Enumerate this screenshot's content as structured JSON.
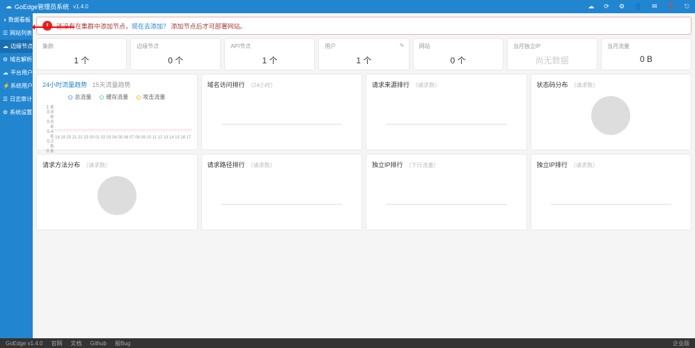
{
  "header": {
    "title": "GoEdge管理员系统",
    "version": "v1.4.0"
  },
  "sidebar": {
    "items": [
      {
        "icon": "◑",
        "label": "数据看板"
      },
      {
        "icon": "☰",
        "label": "网站列表"
      },
      {
        "icon": "☁",
        "label": "边缘节点"
      },
      {
        "icon": "⚙",
        "label": "域名解析"
      },
      {
        "icon": "☁",
        "label": "平台用户"
      },
      {
        "icon": "⚡",
        "label": "系统用户"
      },
      {
        "icon": "☰",
        "label": "日志审计"
      },
      {
        "icon": "⚙",
        "label": "系统设置"
      }
    ]
  },
  "alert": {
    "text_before": "还没有在集群中添加节点，",
    "link": "现在去添加？",
    "text_after": " 添加节点后才可部署网站。"
  },
  "stats": [
    {
      "label": "集群",
      "value": "1 个"
    },
    {
      "label": "边缘节点",
      "value": "0 个"
    },
    {
      "label": "API节点",
      "value": "1 个"
    },
    {
      "label": "用户",
      "value": "1 个",
      "editable": true
    },
    {
      "label": "网站",
      "value": "0 个"
    },
    {
      "label": "当月独立IP",
      "value": "尚无数据",
      "muted": true
    },
    {
      "label": "当月流量",
      "value": "0 B"
    }
  ],
  "traffic_panel": {
    "tab_active": "24小时流量趋势",
    "tab_inactive": "15天流量趋势",
    "legend": [
      "总流量",
      "缓存流量",
      "攻击流量"
    ]
  },
  "chart_data": {
    "type": "line",
    "title": "24小时流量趋势",
    "ylabel": "",
    "ylim": [
      0,
      1
    ],
    "yticks": [
      "1 B",
      "0.8 B",
      "0.6 B",
      "0.4 B",
      "0.2 B",
      "0 B"
    ],
    "categories": [
      "18",
      "19",
      "20",
      "21",
      "22",
      "23",
      "00",
      "01",
      "02",
      "03",
      "04",
      "05",
      "06",
      "07",
      "08",
      "09",
      "10",
      "11",
      "12",
      "13",
      "14",
      "15",
      "16",
      "17"
    ],
    "series": [
      {
        "name": "总流量",
        "values": [
          0,
          0,
          0,
          0,
          0,
          0,
          0,
          0,
          0,
          0,
          0,
          0,
          0,
          0,
          0,
          0,
          0,
          0,
          0,
          0,
          0,
          0,
          0,
          0
        ]
      },
      {
        "name": "缓存流量",
        "values": [
          0,
          0,
          0,
          0,
          0,
          0,
          0,
          0,
          0,
          0,
          0,
          0,
          0,
          0,
          0,
          0,
          0,
          0,
          0,
          0,
          0,
          0,
          0,
          0
        ]
      },
      {
        "name": "攻击流量",
        "values": [
          0,
          0,
          0,
          0,
          0,
          0,
          0,
          0,
          0,
          0,
          0,
          0,
          0,
          0,
          0,
          0,
          0,
          0,
          0,
          0,
          0,
          0,
          0,
          0
        ]
      }
    ]
  },
  "panels_row1": [
    {
      "title": "域名访问排行",
      "sub": "（24小时）"
    },
    {
      "title": "请求来源排行",
      "sub": "（请求数）"
    },
    {
      "title": "状态码分布",
      "sub": "（请求数）",
      "circle": true
    }
  ],
  "panels_row2": [
    {
      "title": "请求方法分布",
      "sub": "（请求数）",
      "circle": true
    },
    {
      "title": "请求路径排行",
      "sub": "（请求数）"
    },
    {
      "title": "独立IP排行",
      "sub": "（下行流量）"
    },
    {
      "title": "独立IP排行",
      "sub": "（请求数）"
    }
  ],
  "footer": {
    "version": "GoEdge v1.4.0",
    "links": [
      "官网",
      "文档",
      "Github",
      "报Bug"
    ],
    "edition": "企业版"
  }
}
